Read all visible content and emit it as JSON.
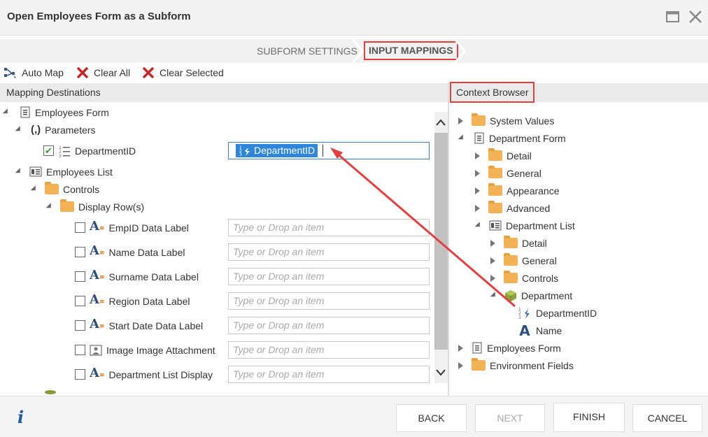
{
  "window": {
    "title": "Open Employees Form as a Subform"
  },
  "wizard": {
    "steps": [
      "SUBFORM SETTINGS",
      "INPUT MAPPINGS"
    ],
    "active": "INPUT MAPPINGS"
  },
  "toolbar": {
    "auto_map": "Auto Map",
    "clear_all": "Clear All",
    "clear_selected": "Clear Selected"
  },
  "panels": {
    "left_header": "Mapping Destinations",
    "right_header": "Context Browser"
  },
  "left_tree": {
    "employees_form": "Employees Form",
    "parameters": "Parameters",
    "param_paren": "(,)",
    "department_id": "DepartmentID",
    "department_id_value": "DepartmentID",
    "employees_list": "Employees List",
    "controls": "Controls",
    "display_rows": "Display Row(s)",
    "fields": [
      {
        "label": "EmpID Data Label"
      },
      {
        "label": "Name Data Label"
      },
      {
        "label": "Surname Data Label"
      },
      {
        "label": "Region Data Label"
      },
      {
        "label": "Start Date Data Label"
      },
      {
        "label": "Image Image Attachment"
      },
      {
        "label": "Department List Display"
      }
    ],
    "placeholder": "Type or Drop an item"
  },
  "right_tree": {
    "system_values": "System Values",
    "department_form": "Department Form",
    "detail": "Detail",
    "general": "General",
    "appearance": "Appearance",
    "advanced": "Advanced",
    "department_list": "Department List",
    "dl_detail": "Detail",
    "dl_general": "General",
    "dl_controls": "Controls",
    "department": "Department",
    "department_id": "DepartmentID",
    "name": "Name",
    "employees_form": "Employees Form",
    "environment_fields": "Environment Fields"
  },
  "footer": {
    "info": "i",
    "back": "BACK",
    "next": "NEXT",
    "finish": "FINISH",
    "cancel": "CANCEL"
  },
  "colors": {
    "accent_blue": "#2f86d8",
    "highlight_red": "#e53e3e",
    "folder": "#f3b256"
  }
}
